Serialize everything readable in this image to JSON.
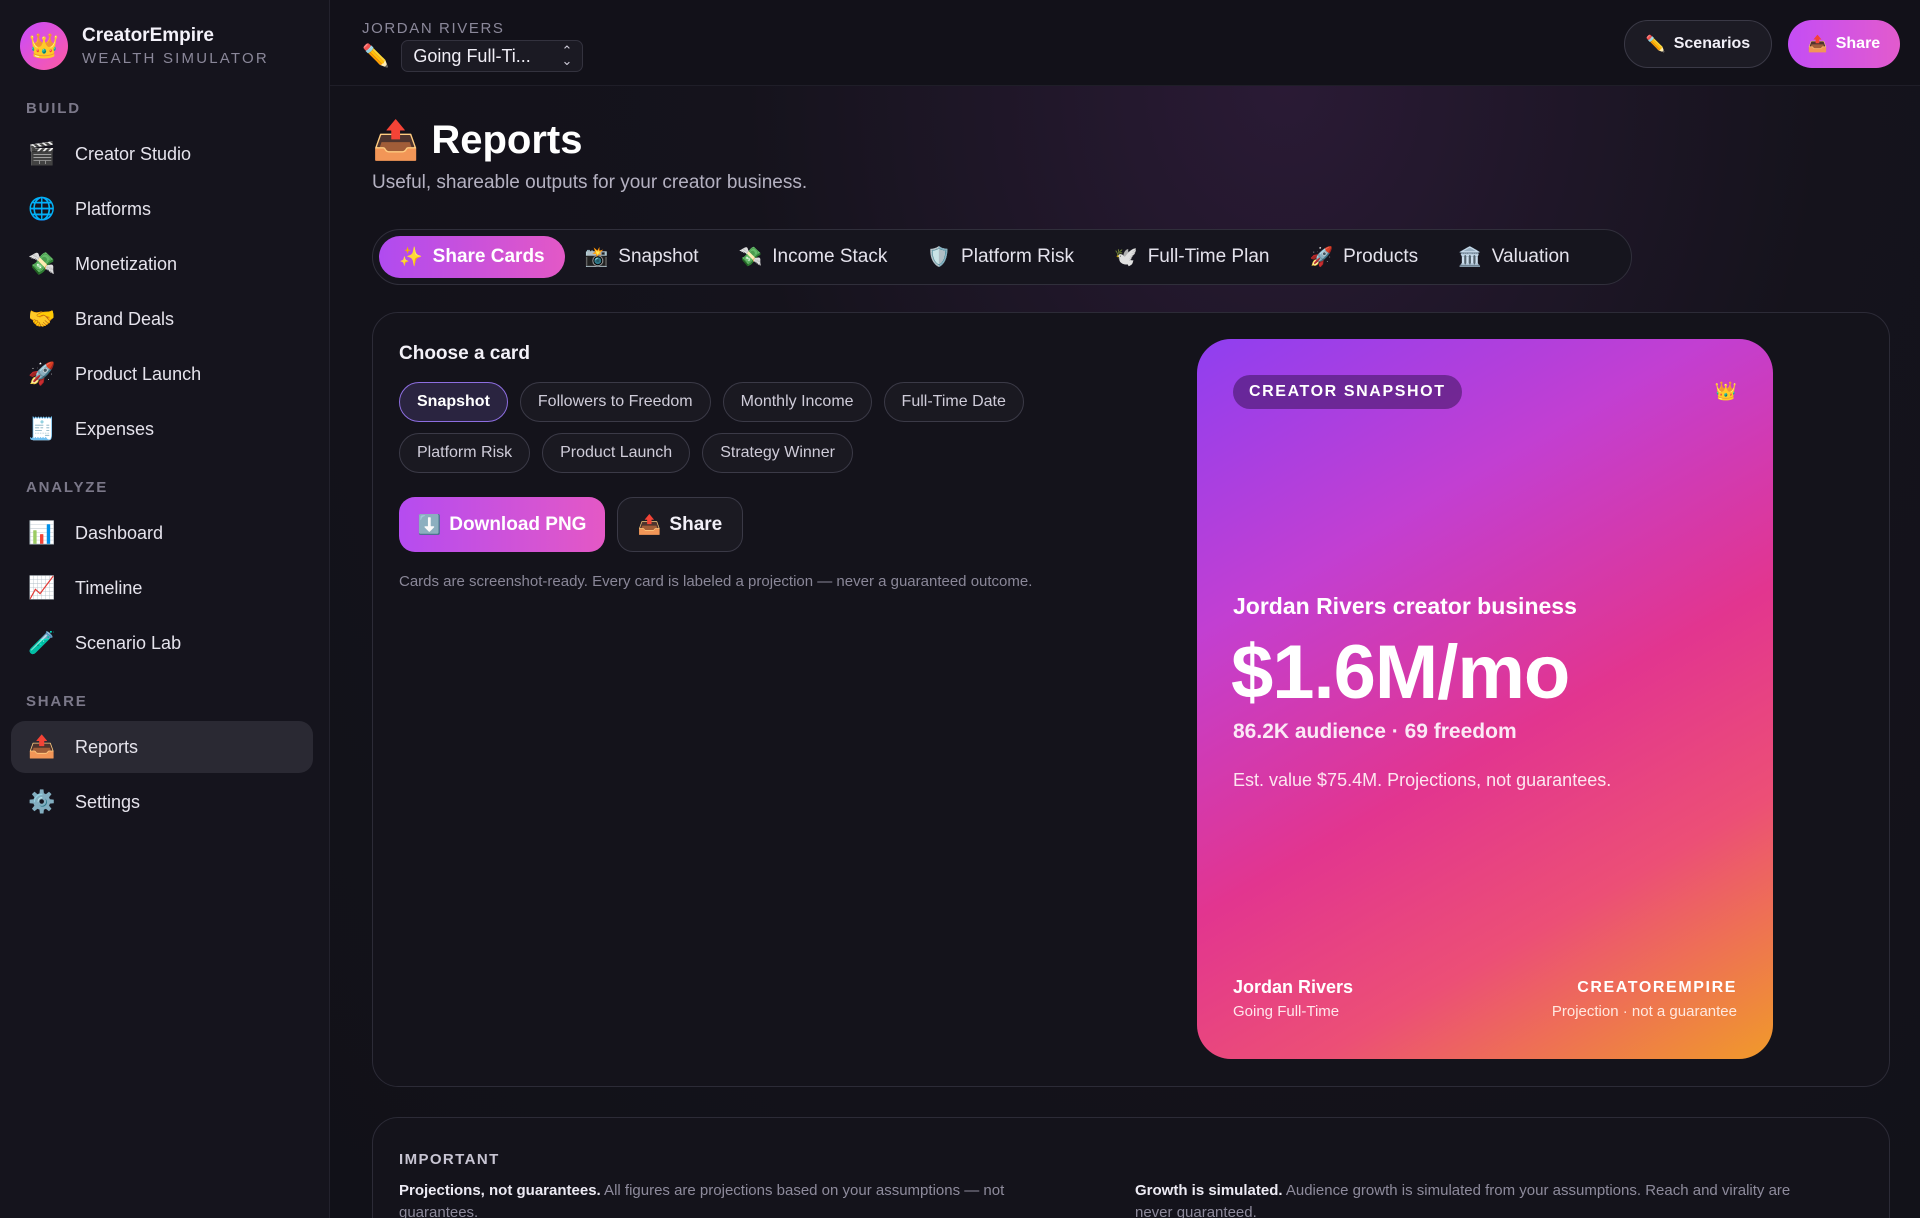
{
  "brand": {
    "name": "CreatorEmpire",
    "sub": "WEALTH SIMULATOR",
    "logo_icon": "👑"
  },
  "sidebar": {
    "sections": [
      {
        "label": "BUILD"
      },
      {
        "label": "ANALYZE"
      },
      {
        "label": "SHARE"
      }
    ],
    "items": [
      {
        "label": "Creator Studio",
        "icon": "🎬"
      },
      {
        "label": "Platforms",
        "icon": "🌐"
      },
      {
        "label": "Monetization",
        "icon": "💸"
      },
      {
        "label": "Brand Deals",
        "icon": "🤝"
      },
      {
        "label": "Product Launch",
        "icon": "🚀"
      },
      {
        "label": "Expenses",
        "icon": "🧾"
      },
      {
        "label": "Dashboard",
        "icon": "📊"
      },
      {
        "label": "Timeline",
        "icon": "📈"
      },
      {
        "label": "Scenario Lab",
        "icon": "🧪"
      },
      {
        "label": "Reports",
        "icon": "📤"
      },
      {
        "label": "Settings",
        "icon": "⚙️"
      }
    ],
    "active": "Reports"
  },
  "topbar": {
    "owner": "JORDAN RIVERS",
    "scenario_icon": "✏️",
    "scenario": "Going Full-Ti...",
    "scenarios_label": "Scenarios",
    "scenarios_icon": "✏️",
    "share_label": "Share",
    "share_icon": "📤"
  },
  "page": {
    "icon": "📤",
    "title": "Reports",
    "subtitle": "Useful, shareable outputs for your creator business."
  },
  "tabs": [
    {
      "label": "Share Cards",
      "icon": "✨"
    },
    {
      "label": "Snapshot",
      "icon": "📸"
    },
    {
      "label": "Income Stack",
      "icon": "💸"
    },
    {
      "label": "Platform Risk",
      "icon": "🛡️"
    },
    {
      "label": "Full-Time Plan",
      "icon": "🕊️"
    },
    {
      "label": "Products",
      "icon": "🚀"
    },
    {
      "label": "Valuation",
      "icon": "🏛️"
    }
  ],
  "chooser": {
    "title": "Choose a card",
    "chips_row1": [
      "Snapshot",
      "Followers to Freedom",
      "Monthly Income",
      "Full-Time Date"
    ],
    "chips_row2": [
      "Platform Risk",
      "Product Launch",
      "Strategy Winner"
    ],
    "selected": "Snapshot",
    "download_label": "Download PNG",
    "download_icon": "⬇️",
    "share_label": "Share",
    "share_icon": "📤",
    "note": "Cards are screenshot-ready. Every card is labeled a projection — never a guaranteed outcome."
  },
  "card": {
    "badge": "CREATOR SNAPSHOT",
    "crown_icon": "👑",
    "title": "Jordan Rivers creator business",
    "big": "$1.6M/mo",
    "stats": "86.2K audience · 69 freedom",
    "value_line": "Est. value $75.4M. Projections, not guarantees.",
    "owner": "Jordan Rivers",
    "scenario": "Going Full-Time",
    "brand": "CREATOREMPIRE",
    "disclaimer": "Projection · not a guarantee",
    "gradient": [
      "#8f3ff0",
      "#e2358f",
      "#f09a2a"
    ]
  },
  "important": {
    "label": "IMPORTANT",
    "col1_bold": "Projections, not guarantees.",
    "col1_text": " All figures are projections based on your assumptions — not guarantees.",
    "col2_bold": "Growth is simulated.",
    "col2_text": " Audience growth is simulated from your assumptions. Reach and virality are never guaranteed."
  },
  "colors": {
    "accent": "#c44df5",
    "accent2": "#e25bcd",
    "bg": "#0f0f17"
  }
}
